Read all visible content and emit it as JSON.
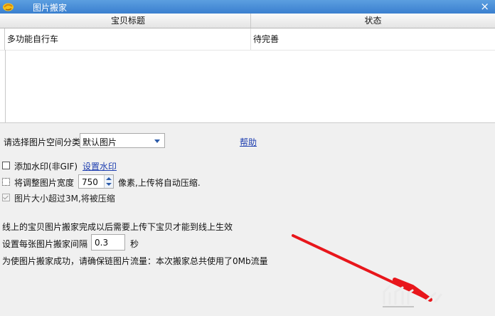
{
  "window": {
    "title": "图片搬家",
    "close_glyph": "×"
  },
  "table": {
    "columns": [
      "宝贝标题",
      "状态"
    ],
    "rows": [
      {
        "title": "多功能自行车",
        "status": "待完善"
      }
    ]
  },
  "form": {
    "category_label": "请选择图片空间分类",
    "category_value": "默认图片",
    "help_link": "帮助",
    "watermark_label": "添加水印(非GIF)",
    "watermark_link": "设置水印",
    "resize_label": "将调整图片宽度",
    "resize_value": "750",
    "resize_suffix": "像素,上传将自动压缩.",
    "compress_label": "图片大小超过3M,将被压缩",
    "notice": "线上的宝贝图片搬家完成以后需要上传下宝贝才能到线上生效",
    "interval_label": "设置每张图片搬家间隔",
    "interval_value": "0.3",
    "interval_unit": "秒",
    "traffic_notice": "为使图片搬家成功，请确保链图片流量：本次搬家总共使用了0Mb流量"
  },
  "colors": {
    "titlebar": "#4a8fd9",
    "arrow": "#e8161b",
    "link": "#1f3fb0"
  },
  "icons": {
    "app": "taobao-logo-icon",
    "close": "close-icon",
    "dropdown": "chevron-down-icon"
  }
}
